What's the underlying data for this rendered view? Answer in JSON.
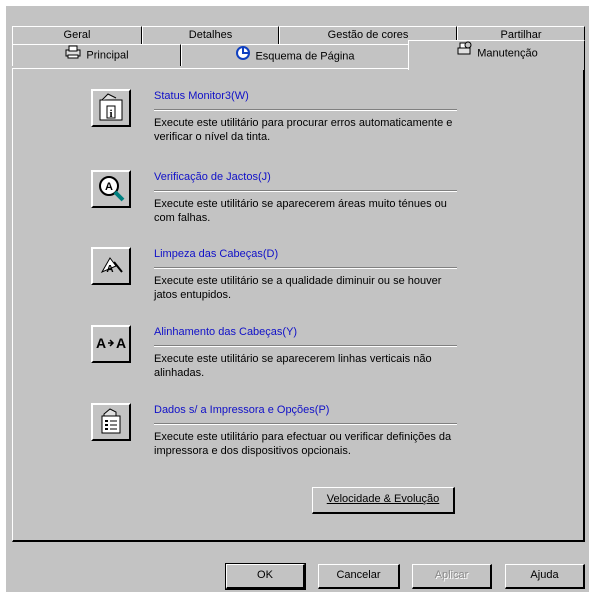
{
  "tabs_back": [
    "Geral",
    "Detalhes",
    "Gestão de cores",
    "Partilhar"
  ],
  "tabs_front": {
    "principal": "Principal",
    "esquema": "Esquema de Página",
    "manutencao": "Manutenção"
  },
  "utilities": [
    {
      "title": "Status Monitor3(W)",
      "desc": "Execute este utilitário para procurar erros automaticamente e verificar o nível da tinta.",
      "icon": "status-monitor-icon"
    },
    {
      "title": "Verificação de Jactos(J)",
      "desc": "Execute este utilitário se aparecerem áreas muito ténues ou com falhas.",
      "icon": "nozzle-check-icon"
    },
    {
      "title": "Limpeza das Cabeças(D)",
      "desc": "Execute este utilitário se a qualidade diminuir ou se houver jatos entupidos.",
      "icon": "head-cleaning-icon"
    },
    {
      "title": "Alinhamento das Cabeças(Y)",
      "desc": "Execute este utilitário se aparecerem linhas verticais não alinhadas.",
      "icon": "head-alignment-icon"
    },
    {
      "title": "Dados s/ a Impressora e Opções(P)",
      "desc": "Execute este utilitário para efectuar ou verificar definições da impressora e dos dispositivos opcionais.",
      "icon": "printer-options-icon"
    }
  ],
  "speed_button": "Velocidade & Evolução",
  "buttons": {
    "ok": "OK",
    "cancel": "Cancelar",
    "apply": "Aplicar",
    "help": "Ajuda"
  },
  "colors": {
    "title_link": "#1010c8",
    "face": "#c3c3c3"
  }
}
